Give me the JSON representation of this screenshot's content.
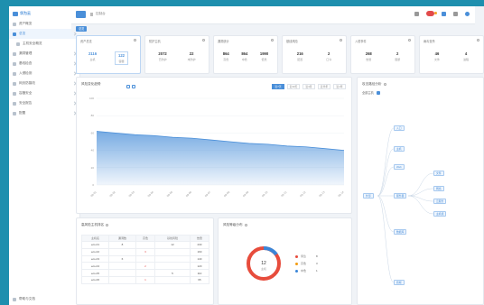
{
  "app": {
    "logo": "华为云"
  },
  "sidebar": {
    "items": [
      {
        "label": "资产概览",
        "active": false
      },
      {
        "label": "总览",
        "active": true
      },
      {
        "label": "主机安全概览",
        "active": false,
        "sub": true
      },
      {
        "label": "漏洞管理",
        "active": false
      },
      {
        "label": "基线检查",
        "active": false
      },
      {
        "label": "入侵检测",
        "active": false
      },
      {
        "label": "网页防篡改",
        "active": false
      },
      {
        "label": "容器安全",
        "active": false
      },
      {
        "label": "安全报告",
        "active": false
      },
      {
        "label": "配置",
        "active": false
      }
    ],
    "footer": "帮助与文档"
  },
  "topbar": {
    "breadcrumb": "控制台"
  },
  "tab": {
    "label": "总览"
  },
  "kpis": [
    {
      "title": "资产总览",
      "values": [
        {
          "v": "2116",
          "l": "主机"
        },
        {
          "v": "122",
          "l": "容器"
        }
      ]
    },
    {
      "title": "防护主机",
      "values": [
        {
          "v": "2072",
          "l": "已防护"
        },
        {
          "v": "22",
          "l": "未防护"
        }
      ]
    },
    {
      "title": "漏洞统计",
      "values": [
        {
          "v": "864",
          "l": "高危"
        },
        {
          "v": "864",
          "l": "中危"
        },
        {
          "v": "1990",
          "l": "低危"
        }
      ]
    },
    {
      "title": "基线风险",
      "values": [
        {
          "v": "216",
          "l": "配置"
        },
        {
          "v": "2",
          "l": "口令"
        }
      ]
    },
    {
      "title": "入侵事件",
      "values": [
        {
          "v": "268",
          "l": "告警"
        },
        {
          "v": "2",
          "l": "阻断"
        }
      ]
    },
    {
      "title": "病毒查杀",
      "values": [
        {
          "v": "46",
          "l": "文件"
        },
        {
          "v": "4",
          "l": "进程"
        }
      ]
    }
  ],
  "trend": {
    "title": "风险变化趋势",
    "ranges": [
      "近7天",
      "近30天",
      "近3月",
      "近半年",
      "近1年"
    ]
  },
  "chart_data": {
    "type": "area",
    "x": [
      "09-01",
      "09-02",
      "09-03",
      "09-04",
      "09-05",
      "09-06",
      "09-07",
      "09-08",
      "09-09",
      "09-10",
      "09-11",
      "09-12",
      "09-13",
      "09-14"
    ],
    "values": [
      62,
      60,
      58,
      57,
      55,
      54,
      52,
      50,
      48,
      47,
      45,
      44,
      42,
      40
    ],
    "ylim": [
      0,
      100
    ],
    "yticks": [
      "0",
      "20",
      "40",
      "60",
      "80",
      "100"
    ],
    "color": "#4a8fd9",
    "grid": true
  },
  "users": {
    "title": "高风险主机排名",
    "headers": [
      "主机名",
      "漏洞数",
      "高危",
      "基线风险",
      "告警"
    ],
    "rows": [
      [
        "ecs-01",
        "8",
        "",
        "12",
        "230"
      ],
      [
        "ecs-02",
        "",
        "3",
        "",
        "160"
      ],
      [
        "ecs-03",
        "6",
        "",
        "",
        "140"
      ],
      [
        "ecs-04",
        "",
        "2",
        "",
        "120"
      ],
      [
        "ecs-05",
        "",
        "",
        "5",
        "110"
      ],
      [
        "ecs-06",
        "",
        "1",
        "",
        "95"
      ]
    ]
  },
  "dist": {
    "title": "风险等级分布",
    "center_value": "12",
    "center_label": "主机",
    "legend": [
      {
        "label": "紧急",
        "value": "8",
        "color": "#e74c3c"
      },
      {
        "label": "高危",
        "value": "3",
        "color": "#f39c12"
      },
      {
        "label": "中危",
        "value": "1",
        "color": "#3b86d8"
      }
    ]
  },
  "flow": {
    "title": "攻击路径分析",
    "filter_label": "全部主机",
    "nodes": [
      "外部",
      "入口",
      "主机",
      "Web",
      "服务器",
      "数据库",
      "终端",
      "文件",
      "网络",
      "云服务",
      "主机组"
    ]
  }
}
